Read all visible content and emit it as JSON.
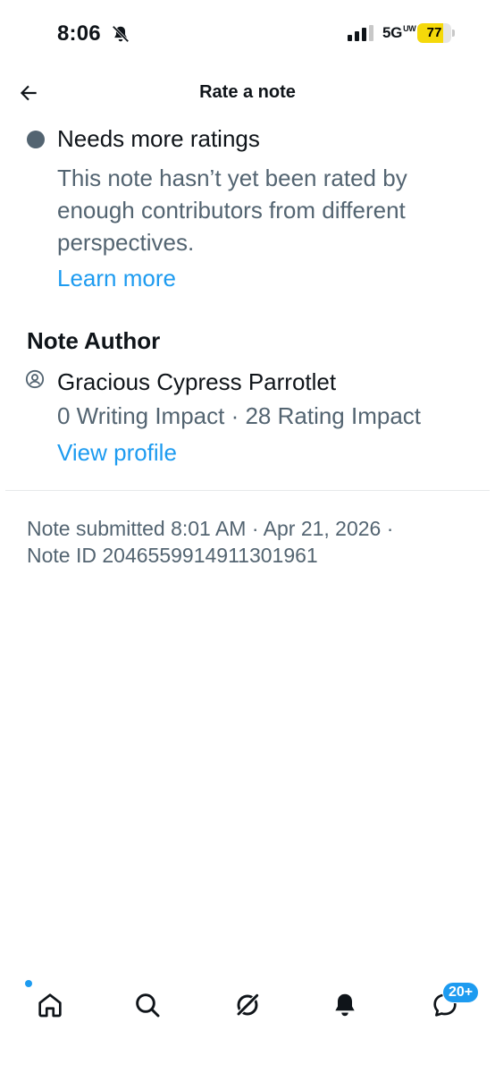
{
  "status_bar": {
    "time": "8:06",
    "network": "5G",
    "network_suffix": "UW",
    "battery": "77",
    "battery_level": 0.77
  },
  "header": {
    "title": "Rate a note"
  },
  "note_status": {
    "title": "Needs more ratings",
    "description": "This note hasn’t yet been rated by enough contributors from different perspectives.",
    "learn_more": "Learn more"
  },
  "author": {
    "heading": "Note Author",
    "name": "Gracious Cypress Parrotlet",
    "impact": "0 Writing Impact · 28 Rating Impact",
    "view_profile": "View profile"
  },
  "meta": {
    "line1": "Note submitted 8:01 AM · Apr 21, 2026 ·",
    "line2": "Note ID 2046559914911301961"
  },
  "bottom_nav": {
    "messages_badge": "20+"
  },
  "colors": {
    "accent": "#1d9bf0",
    "secondary_text": "#536471",
    "battery": "#f5d90a"
  }
}
